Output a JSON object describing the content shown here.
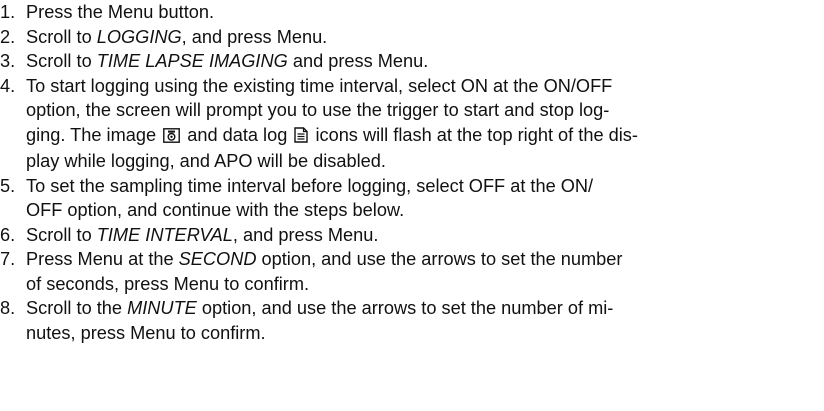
{
  "steps": [
    {
      "number": "1.",
      "lines": [
        {
          "parts": [
            {
              "text": "Press the Menu button."
            }
          ]
        }
      ]
    },
    {
      "number": "2.",
      "lines": [
        {
          "parts": [
            {
              "text": "Scroll to "
            },
            {
              "text": "LOGGING"
            },
            {
              "text": ", and press Menu."
            }
          ]
        }
      ]
    },
    {
      "number": "3.",
      "lines": [
        {
          "parts": [
            {
              "text": "Scroll to "
            },
            {
              "text": "TIME LAPSE IMAGING"
            },
            {
              "text": " and press Menu."
            }
          ]
        }
      ]
    },
    {
      "number": "4.",
      "lines": [
        {
          "parts": [
            {
              "text": "To start logging using the existing time interval, select ON at the ON/OFF"
            }
          ]
        },
        {
          "parts": [
            {
              "text": "option, the screen will prompt you to use the trigger to start and stop log-"
            }
          ]
        },
        {
          "parts": [
            {
              "text": "ging. The image "
            },
            {
              "text": " and data log "
            },
            {
              "text": " icons will flash at the top right of the dis-"
            }
          ]
        },
        {
          "parts": [
            {
              "text": "play while logging, and APO will be disabled."
            }
          ]
        }
      ]
    },
    {
      "number": "5.",
      "lines": [
        {
          "parts": [
            {
              "text": "To set the sampling time interval before logging, select OFF at the ON/"
            }
          ]
        },
        {
          "parts": [
            {
              "text": "OFF option, and continue with the steps below."
            }
          ]
        }
      ]
    },
    {
      "number": "6.",
      "lines": [
        {
          "parts": [
            {
              "text": "Scroll to "
            },
            {
              "text": "TIME INTERVAL"
            },
            {
              "text": ", and press Menu."
            }
          ]
        }
      ]
    },
    {
      "number": "7.",
      "lines": [
        {
          "parts": [
            {
              "text": "Press Menu at the "
            },
            {
              "text": "SECOND"
            },
            {
              "text": " option, and use the arrows to set the number"
            }
          ]
        },
        {
          "parts": [
            {
              "text": "of seconds, press Menu to confirm."
            }
          ]
        }
      ]
    },
    {
      "number": "8.",
      "lines": [
        {
          "parts": [
            {
              "text": "Scroll to the "
            },
            {
              "text": "MINUTE"
            },
            {
              "text": " option, and use the arrows to set the number of mi-"
            }
          ]
        },
        {
          "parts": [
            {
              "text": "nutes, press Menu to confirm."
            }
          ]
        }
      ]
    }
  ],
  "icons": {
    "image": "camera-icon",
    "data_log": "document-icon"
  }
}
